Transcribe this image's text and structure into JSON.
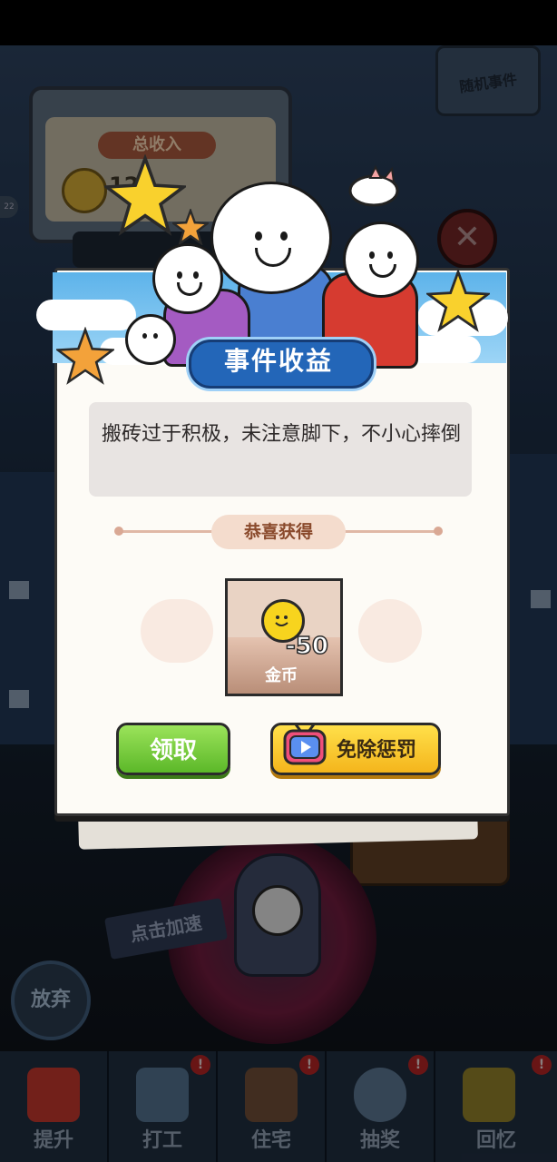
{
  "background": {
    "income_board": {
      "label": "总收入",
      "value": "12"
    },
    "random_event_label": "随机事件",
    "left_badge": "22",
    "speed_tag": "点击加速",
    "giveup_button": "放弃"
  },
  "bottom_nav": {
    "items": [
      {
        "label": "提升",
        "icon": "book-icon",
        "badge": ""
      },
      {
        "label": "打工",
        "icon": "id-badge-icon",
        "badge": "!"
      },
      {
        "label": "住宅",
        "icon": "house-icon",
        "badge": "!"
      },
      {
        "label": "抽奖",
        "icon": "gacha-machine-icon",
        "badge": "!"
      },
      {
        "label": "回忆",
        "icon": "camera-icon",
        "badge": "!"
      }
    ]
  },
  "dialog": {
    "title": "事件收益",
    "description": "搬砖过于积极，未注意脚下，不小心摔倒",
    "congrats_label": "恭喜获得",
    "reward": {
      "amount": "-50",
      "name": "金币",
      "icon": "gold-coin-icon"
    },
    "claim_button": "领取",
    "free_button": "免除惩罚",
    "free_button_icon": "tv-video-icon"
  },
  "colors": {
    "title_plate": "#2366b8",
    "claim_button": "#5cb829",
    "free_button": "#f4b51c",
    "coin": "#f7d41e"
  }
}
